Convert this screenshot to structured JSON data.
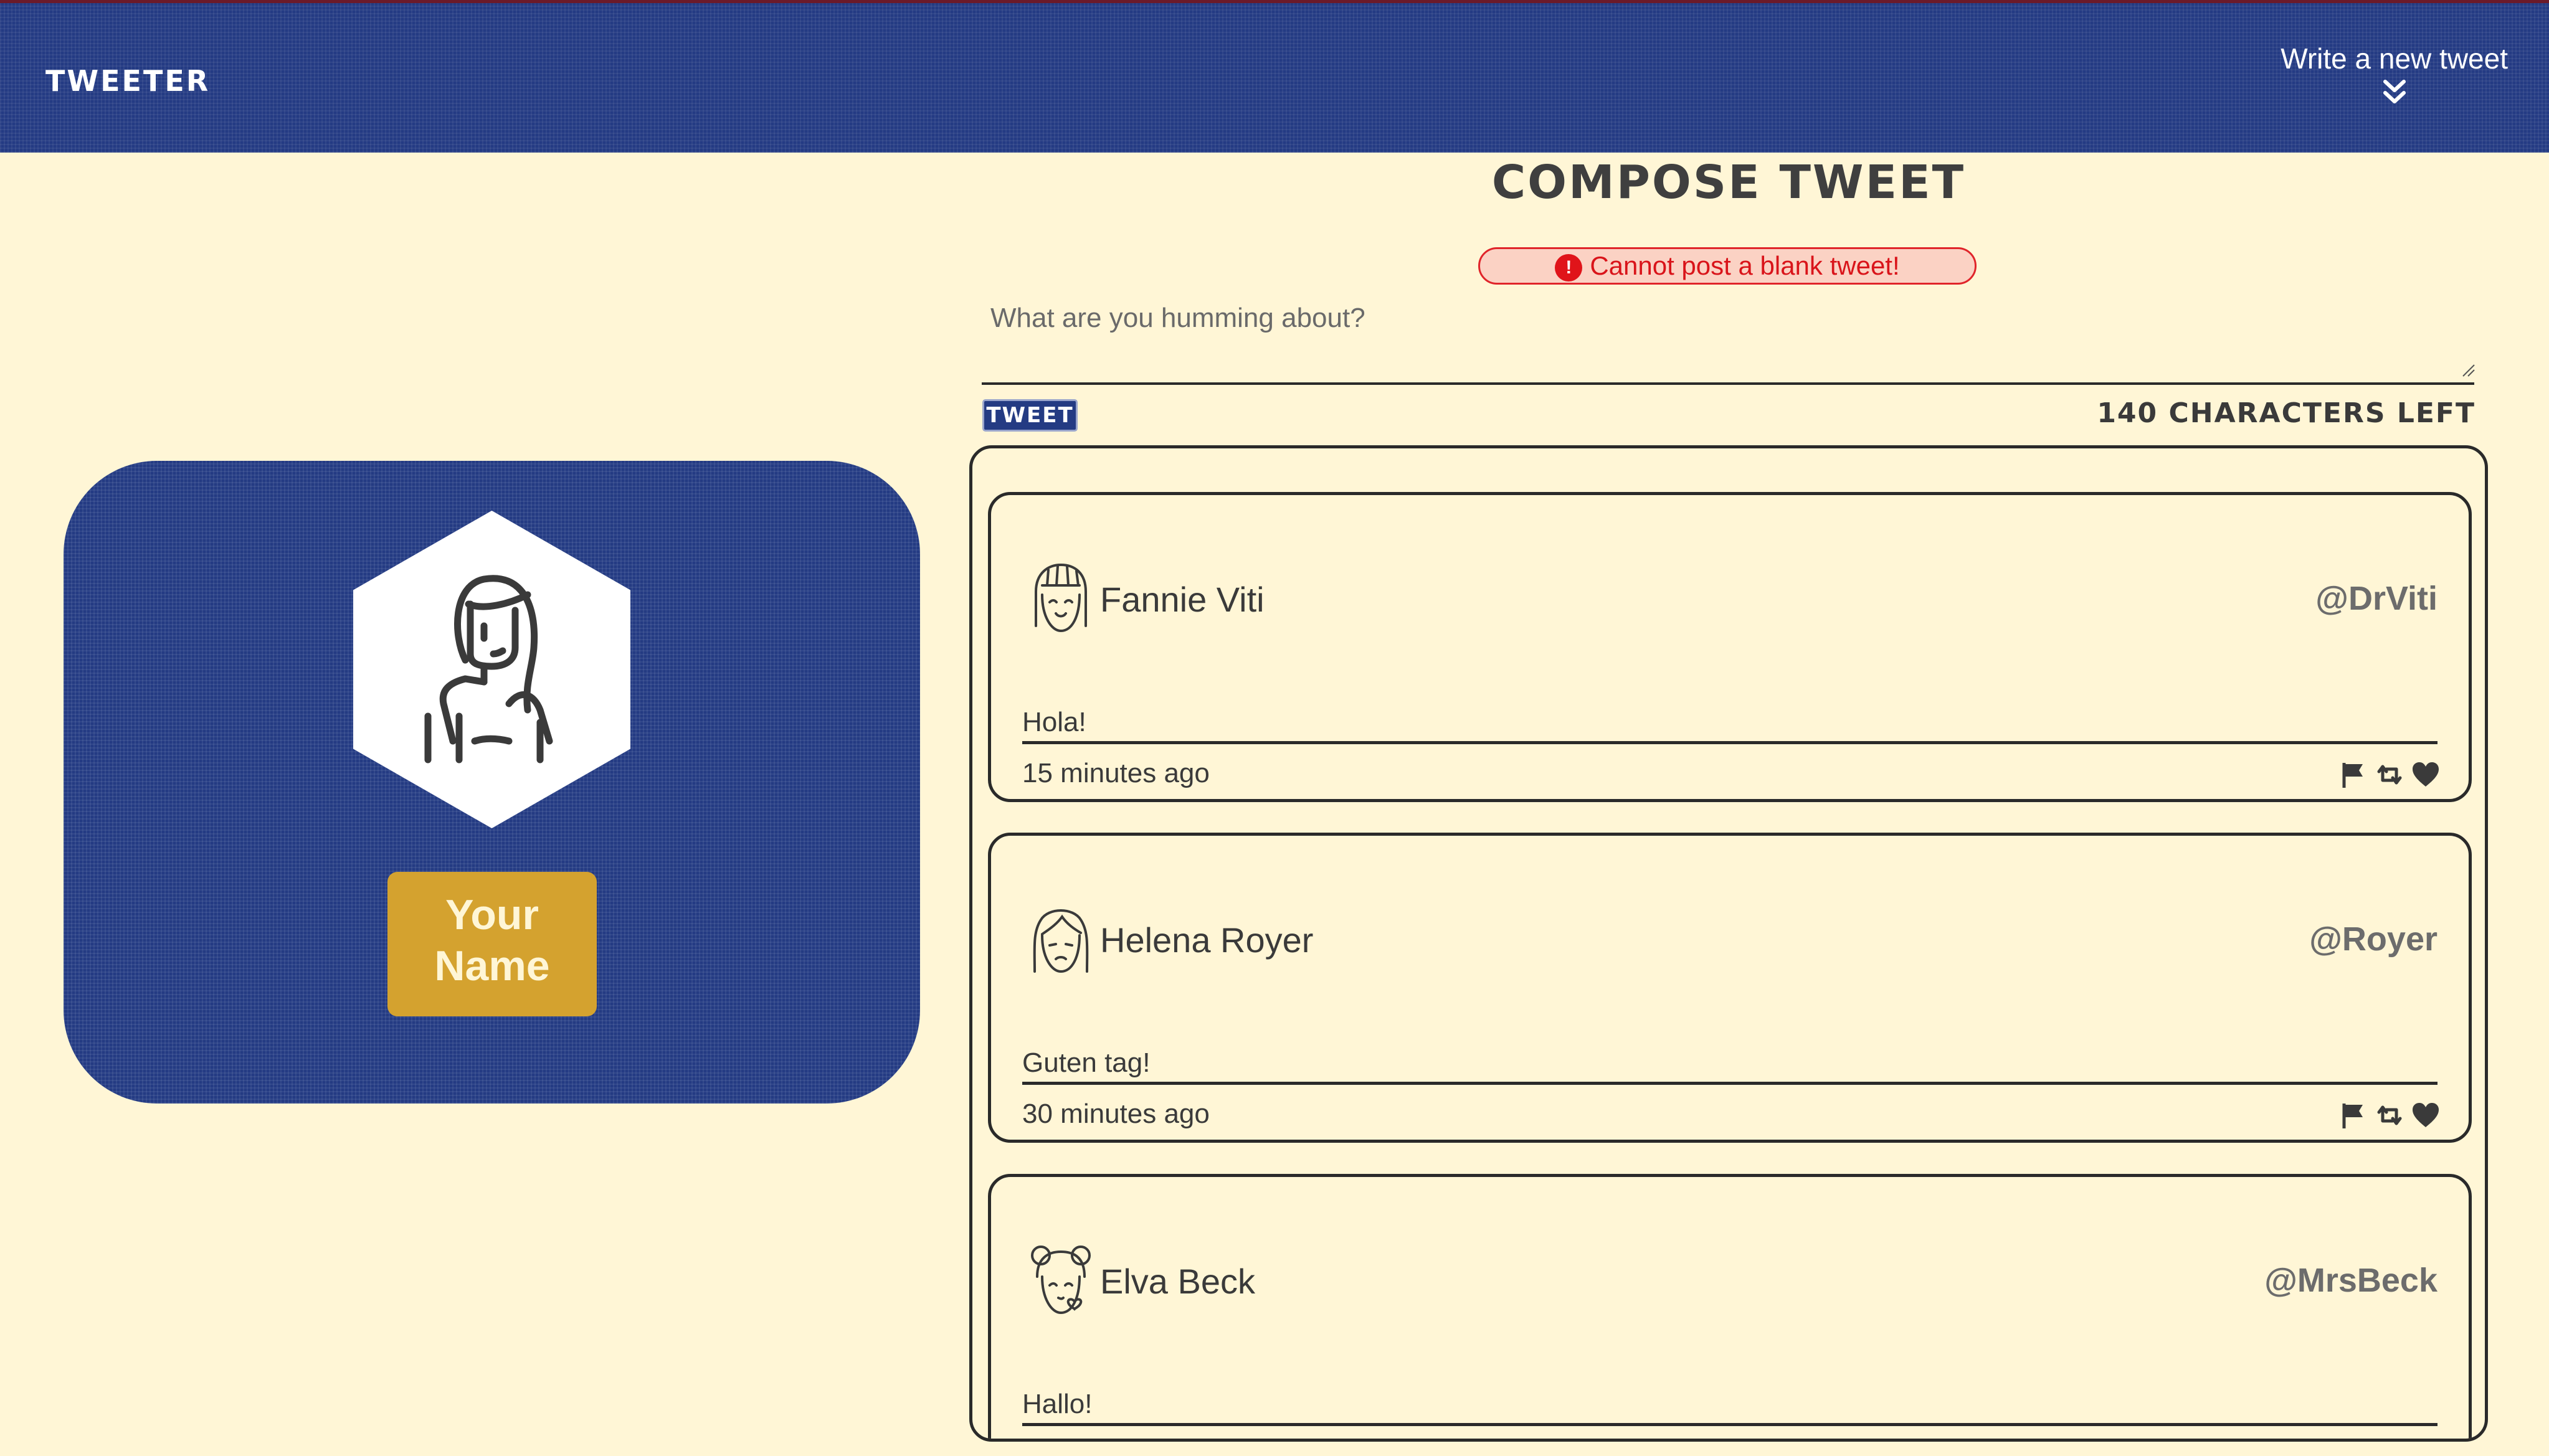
{
  "nav": {
    "brand": "TWEETER",
    "write_label": "Write a new tweet",
    "chevron_icon": "double-chevron-down-icon"
  },
  "profile": {
    "avatar_icon": "woman-avatar-icon",
    "name_line1": "Your",
    "name_line2": "Name"
  },
  "compose": {
    "title": "COMPOSE TWEET",
    "error": "Cannot post a blank tweet!",
    "error_icon": "alert-icon",
    "placeholder": "What are you humming about?",
    "value": "",
    "submit_label": "TWEET",
    "counter": "140 CHARACTERS LEFT"
  },
  "tweets": [
    {
      "name": "Fannie Viti",
      "handle": "@DrViti",
      "content": "Hola!",
      "time": "15 minutes ago",
      "avatar_icon": "girl-bangs-avatar-icon"
    },
    {
      "name": "Helena Royer",
      "handle": "@Royer",
      "content": "Guten tag!",
      "time": "30 minutes ago",
      "avatar_icon": "girl-frown-avatar-icon"
    },
    {
      "name": "Elva Beck",
      "handle": "@MrsBeck",
      "content": "Hallo!",
      "time": "",
      "avatar_icon": "girl-buns-avatar-icon"
    }
  ],
  "colors": {
    "background": "#fff6d6",
    "nav": "#243b83",
    "accent_gold": "#d4a22f",
    "error_red": "#e0242a",
    "ink": "#2a2a2a"
  }
}
